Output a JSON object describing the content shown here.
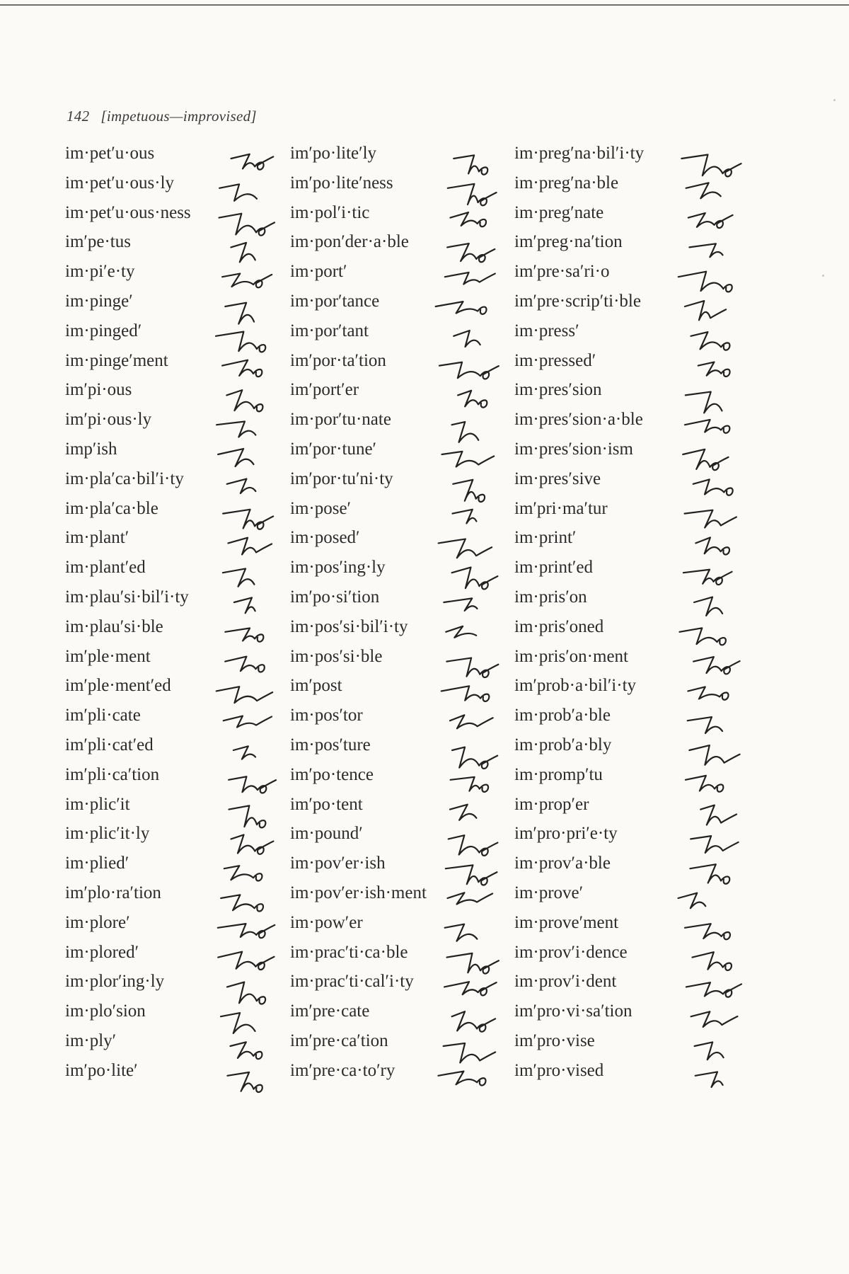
{
  "page": {
    "number": "142",
    "range": "[impetuous—improvised]"
  },
  "columns": [
    {
      "entries": [
        "im·pet′u·ous",
        "im·pet′u·ous·ly",
        "im·pet′u·ous·ness",
        "im′pe·tus",
        "im·pi′e·ty",
        "im·pinge′",
        "im·pinged′",
        "im·pinge′ment",
        "im′pi·ous",
        "im′pi·ous·ly",
        "imp′ish",
        "im·pla′ca·bil′i·ty",
        "im·pla′ca·ble",
        "im·plant′",
        "im·plant′ed",
        "im·plau′si·bil′i·ty",
        "im·plau′si·ble",
        "im′ple·ment",
        "im′ple·ment′ed",
        "im′pli·cate",
        "im′pli·cat′ed",
        "im′pli·ca′tion",
        "im·plic′it",
        "im·plic′it·ly",
        "im·plied′",
        "im′plo·ra′tion",
        "im·plore′",
        "im·plored′",
        "im·plor′ing·ly",
        "im·plo′sion",
        "im·ply′",
        "im′po·lite′"
      ]
    },
    {
      "entries": [
        "im′po·lite′ly",
        "im′po·lite′ness",
        "im·pol′i·tic",
        "im·pon′der·a·ble",
        "im·port′",
        "im·por′tance",
        "im·por′tant",
        "im′por·ta′tion",
        "im′port′er",
        "im·por′tu·nate",
        "im′por·tune′",
        "im′por·tu′ni·ty",
        "im·pose′",
        "im·posed′",
        "im·pos′ing·ly",
        "im′po·si′tion",
        "im·pos′si·bil′i·ty",
        "im·pos′si·ble",
        "im′post",
        "im·pos′tor",
        "im·pos′ture",
        "im′po·tence",
        "im′po·tent",
        "im·pound′",
        "im·pov′er·ish",
        "im·pov′er·ish·ment",
        "im·pow′er",
        "im·prac′ti·ca·ble",
        "im·prac′ti·cal′i·ty",
        "im′pre·cate",
        "im′pre·ca′tion",
        "im′pre·ca·to′ry"
      ]
    },
    {
      "entries": [
        "im·preg′na·bil′i·ty",
        "im·preg′na·ble",
        "im·preg′nate",
        "im′preg·na′tion",
        "im′pre·sa′ri·o",
        "im′pre·scrip′ti·ble",
        "im·press′",
        "im·pressed′",
        "im·pres′sion",
        "im·pres′sion·a·ble",
        "im·pres′sion·ism",
        "im·pres′sive",
        "im′pri·ma′tur",
        "im·print′",
        "im·print′ed",
        "im·pris′on",
        "im·pris′oned",
        "im·pris′on·ment",
        "im′prob·a·bil′i·ty",
        "im·prob′a·ble",
        "im·prob′a·bly",
        "im·promp′tu",
        "im·prop′er",
        "im′pro·pri′e·ty",
        "im·prov′a·ble",
        "im·prove′",
        "im·prove′ment",
        "im·prov′i·dence",
        "im·prov′i·dent",
        "im′pro·vi·sa′tion",
        "im′pro·vise",
        "im′pro·vised"
      ]
    }
  ]
}
